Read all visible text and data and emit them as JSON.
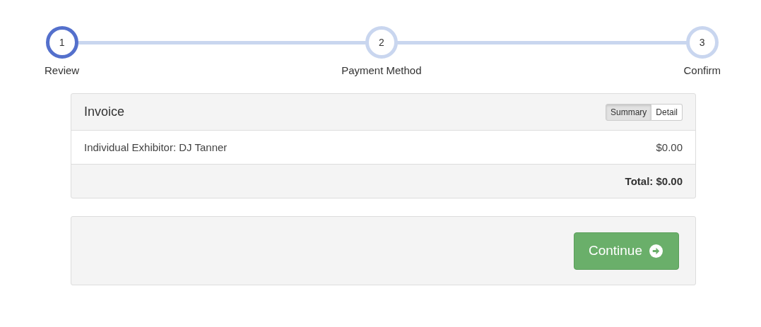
{
  "steps": [
    {
      "number": "1",
      "label": "Review",
      "selected": true
    },
    {
      "number": "2",
      "label": "Payment Method",
      "selected": false
    },
    {
      "number": "3",
      "label": "Confirm",
      "selected": false
    }
  ],
  "invoice": {
    "title": "Invoice",
    "views": [
      {
        "label": "Summary",
        "selected": true
      },
      {
        "label": "Detail",
        "selected": false
      }
    ],
    "items": [
      {
        "description": "Individual Exhibitor: DJ Tanner",
        "amount": "$0.00"
      }
    ],
    "total": "Total: $0.00"
  },
  "continue_button": "Continue"
}
